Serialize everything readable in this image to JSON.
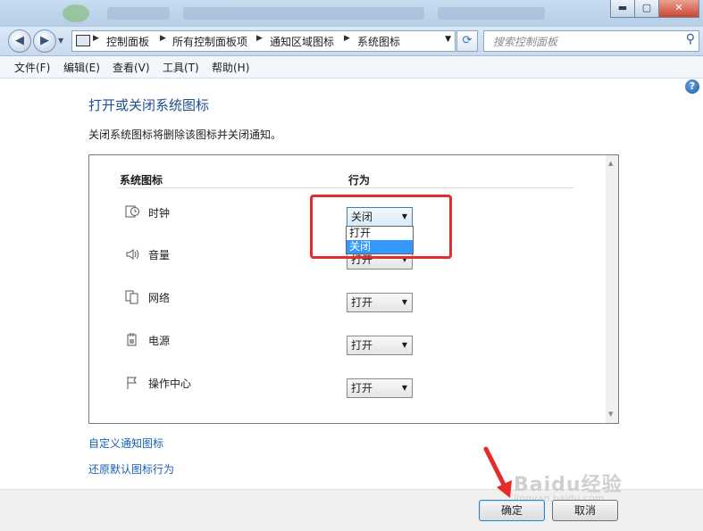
{
  "window": {
    "minimize": "▬",
    "maximize": "▢",
    "close": "✕"
  },
  "nav": {
    "back": "◀",
    "forward": "▶",
    "breadcrumbs": [
      "控制面板",
      "所有控制面板项",
      "通知区域图标",
      "系统图标"
    ],
    "refresh": "⟳",
    "search_placeholder": "搜索控制面板",
    "search_icon": "magnifier-icon"
  },
  "menus": [
    "文件(F)",
    "编辑(E)",
    "查看(V)",
    "工具(T)",
    "帮助(H)"
  ],
  "page": {
    "help": "?",
    "heading": "打开或关闭系统图标",
    "description": "关闭系统图标将删除该图标并关闭通知。",
    "col_icon": "系统图标",
    "col_behavior": "行为",
    "rows": [
      {
        "label": "时钟",
        "value": "关闭",
        "icon": "clock-icon"
      },
      {
        "label": "音量",
        "value": "打开",
        "icon": "speaker-icon"
      },
      {
        "label": "网络",
        "value": "打开",
        "icon": "network-icon"
      },
      {
        "label": "电源",
        "value": "打开",
        "icon": "power-icon"
      },
      {
        "label": "操作中心",
        "value": "打开",
        "icon": "flag-icon"
      }
    ],
    "dropdown_options": [
      "打开",
      "关闭"
    ],
    "dropdown_selected": "关闭",
    "link_customize": "自定义通知图标",
    "link_restore": "还原默认图标行为"
  },
  "buttons": {
    "ok": "确定",
    "cancel": "取消"
  },
  "watermark": {
    "line1": "Baidu经验",
    "line2": "jingyan.baidu.com"
  },
  "colors": {
    "accent": "#1f4f8f",
    "link": "#1a5fb4",
    "highlight": "#e52b2b",
    "selection": "#3399ff"
  }
}
